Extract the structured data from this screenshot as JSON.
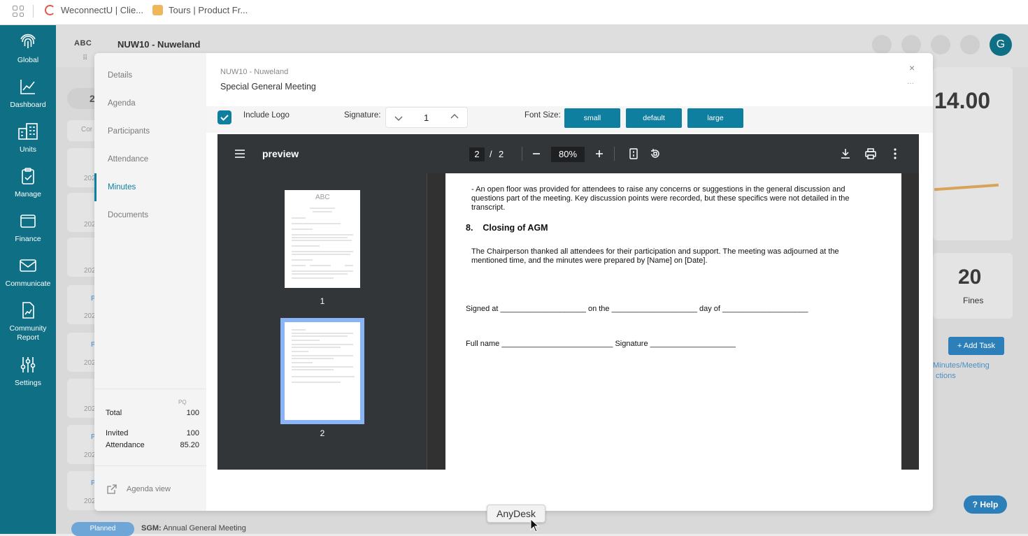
{
  "browser": {
    "tabs": [
      {
        "title": "WeconnectU | Clie..."
      },
      {
        "title": "Tours | Product Fr..."
      }
    ]
  },
  "nav": {
    "items": [
      {
        "label": "Global",
        "icon": "fingerprint-icon"
      },
      {
        "label": "Dashboard",
        "icon": "chart-line-icon"
      },
      {
        "label": "Units",
        "icon": "building-icon"
      },
      {
        "label": "Manage",
        "icon": "clipboard-check-icon"
      },
      {
        "label": "Finance",
        "icon": "wallet-icon"
      },
      {
        "label": "Communicate",
        "icon": "envelope-icon"
      },
      {
        "label": "Community Report",
        "icon": "report-icon"
      },
      {
        "label": "Settings",
        "icon": "sliders-icon"
      }
    ]
  },
  "background": {
    "logo": "ABC",
    "title": "NUW10 - Nuweland",
    "avatar_initial": "G",
    "big_number": "14.00",
    "fines_count": "20",
    "fines_label": "Fines",
    "add_task": "+ Add Task",
    "minutes_link": "Minutes/Meeting",
    "actions_link": "ctions",
    "help": "Help",
    "bottom_status": "Planned",
    "bottom_meeting_prefix": "SGM:",
    "bottom_meeting": "Annual General Meeting",
    "left_numbers": [
      "2",
      "Cor",
      "202",
      "202",
      "202",
      "P",
      "202",
      "P",
      "202",
      "202",
      "P",
      "202",
      "P",
      "202"
    ]
  },
  "modal": {
    "breadcrumb": "NUW10 - Nuweland",
    "title": "Special General Meeting",
    "close": "×",
    "more": "···",
    "sidebar": {
      "items": [
        {
          "label": "Details"
        },
        {
          "label": "Agenda"
        },
        {
          "label": "Participants"
        },
        {
          "label": "Attendance"
        },
        {
          "label": "Minutes"
        },
        {
          "label": "Documents"
        }
      ],
      "stats_header": "PQ",
      "total_label": "Total",
      "total_value": "100",
      "invited_label": "Invited",
      "invited_value": "100",
      "attendance_label": "Attendance",
      "attendance_value": "85.20",
      "agenda_view": "Agenda view"
    },
    "options": {
      "include_logo": "Include Logo",
      "signature_label": "Signature:",
      "signature_value": "1",
      "font_size_label": "Font Size:",
      "sizes": [
        "small",
        "default",
        "large"
      ]
    },
    "pdf": {
      "title": "preview",
      "current_page": "2",
      "page_sep": "/",
      "total_pages": "2",
      "zoom": "80%",
      "thumb_labels": [
        "1",
        "2"
      ],
      "thumb_logo": "ABC",
      "content": {
        "para1_line1": "- An open floor was provided for attendees to raise any concerns or suggestions in the general discussion and",
        "para1_line2": "questions part of the meeting. Key discussion points were recorded, but these specifics were not detailed in the",
        "para1_line3": "transcript.",
        "heading": "8.    Closing of AGM",
        "para2_line1": "The Chairperson thanked all attendees for their participation and support. The meeting was adjourned at the",
        "para2_line2": "mentioned time, and the minutes were prepared by [Name] on [Date].",
        "signed_line": "Signed at ____________________ on the ____________________ day of ____________________",
        "fullname_line": "Full name __________________________ Signature ____________________"
      }
    }
  },
  "overlay": {
    "anydesk": "AnyDesk"
  }
}
